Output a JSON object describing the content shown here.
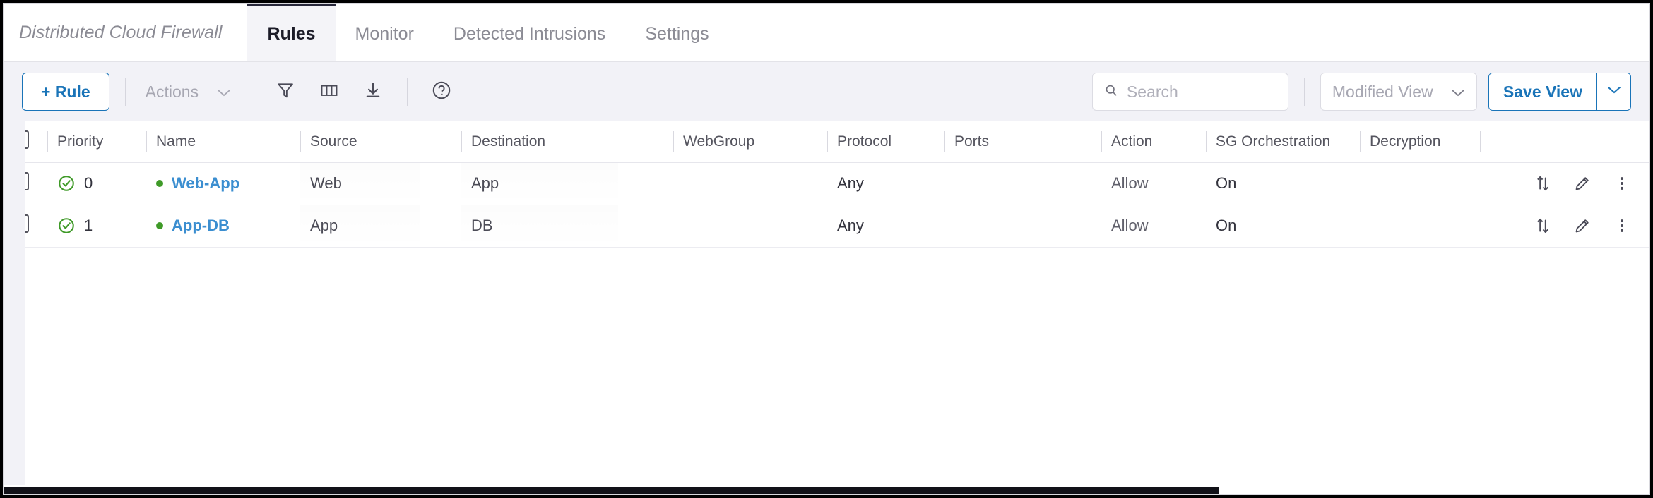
{
  "app": {
    "title": "Distributed Cloud Firewall"
  },
  "tabs": [
    {
      "label": "Rules",
      "active": true
    },
    {
      "label": "Monitor",
      "active": false
    },
    {
      "label": "Detected Intrusions",
      "active": false
    },
    {
      "label": "Settings",
      "active": false
    }
  ],
  "toolbar": {
    "add_rule_label": "+ Rule",
    "actions_label": "Actions",
    "actions_caret": "⌄",
    "filter_icon": "filter-icon",
    "columns_icon": "columns-icon",
    "download_icon": "download-icon",
    "help_icon": "help-circle-icon",
    "search": {
      "placeholder": "Search",
      "value": "",
      "icon": "search-icon"
    },
    "view_select": {
      "value": "Modified View",
      "caret": "⌄"
    },
    "save_view_label": "Save View",
    "save_view_caret": "⌄"
  },
  "table": {
    "columns": [
      "Priority",
      "Name",
      "Source",
      "Destination",
      "WebGroup",
      "Protocol",
      "Ports",
      "Action",
      "SG Orchestration",
      "Decryption"
    ],
    "rows": [
      {
        "priority": "0",
        "status_icon": "check-circle-icon",
        "name": "Web-App",
        "name_dot_color": "#3f9a28",
        "source": "Web",
        "destination": "App",
        "webgroup": "",
        "protocol": "Any",
        "ports": "",
        "action": "Allow",
        "sg_orchestration": "On",
        "decryption": "",
        "row_icons": [
          "reorder-icon",
          "edit-pencil-icon",
          "more-vertical-icon"
        ]
      },
      {
        "priority": "1",
        "status_icon": "check-circle-icon",
        "name": "App-DB",
        "name_dot_color": "#3f9a28",
        "source": "App",
        "destination": "DB",
        "webgroup": "",
        "protocol": "Any",
        "ports": "",
        "action": "Allow",
        "sg_orchestration": "On",
        "decryption": "",
        "row_icons": [
          "reorder-icon",
          "edit-pencil-icon",
          "more-vertical-icon"
        ]
      }
    ]
  },
  "colors": {
    "accent_blue": "#1a74b8",
    "link_blue": "#3b8ed0",
    "status_green": "#3f9a28",
    "toolbar_bg": "#f2f2f7",
    "active_tab_border": "#27273a"
  }
}
